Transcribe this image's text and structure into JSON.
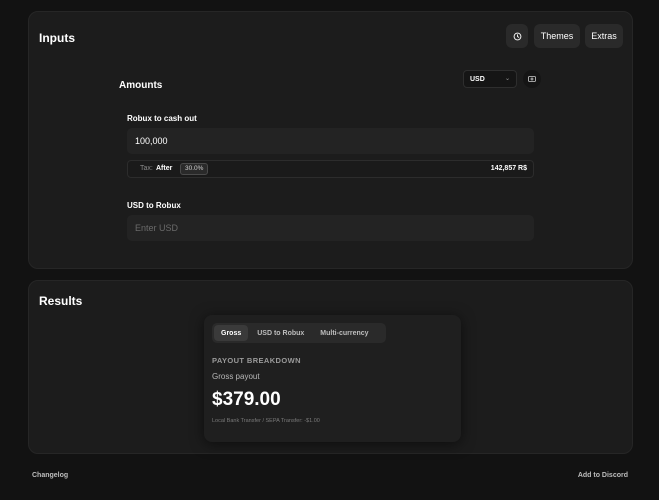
{
  "inputs_panel": {
    "title": "Inputs",
    "history_icon": "clock-icon",
    "themes_label": "Themes",
    "extras_label": "Extras",
    "amounts": {
      "title": "Amounts",
      "currency": "USD",
      "currency_icon": "money-icon",
      "robux_field": {
        "label": "Robux to cash out",
        "value": "100,000"
      },
      "tax": {
        "label": "Tax:",
        "mode": "After",
        "rate": "30.0%",
        "result": "142,857 R$"
      },
      "usd_field": {
        "label": "USD to Robux",
        "placeholder": "Enter USD"
      }
    }
  },
  "results_panel": {
    "title": "Results",
    "tabs": [
      {
        "label": "Gross",
        "active": true
      },
      {
        "label": "USD to Robux",
        "active": false
      },
      {
        "label": "Multi-currency",
        "active": false
      }
    ],
    "breakdown_title": "PAYOUT BREAKDOWN",
    "gross_label": "Gross payout",
    "gross_amount": "$379.00",
    "transfer_note": "Local Bank Transfer / SEPA Transfer: -$1.00"
  },
  "footer": {
    "changelog": "Changelog",
    "discord": "Add to Discord"
  }
}
